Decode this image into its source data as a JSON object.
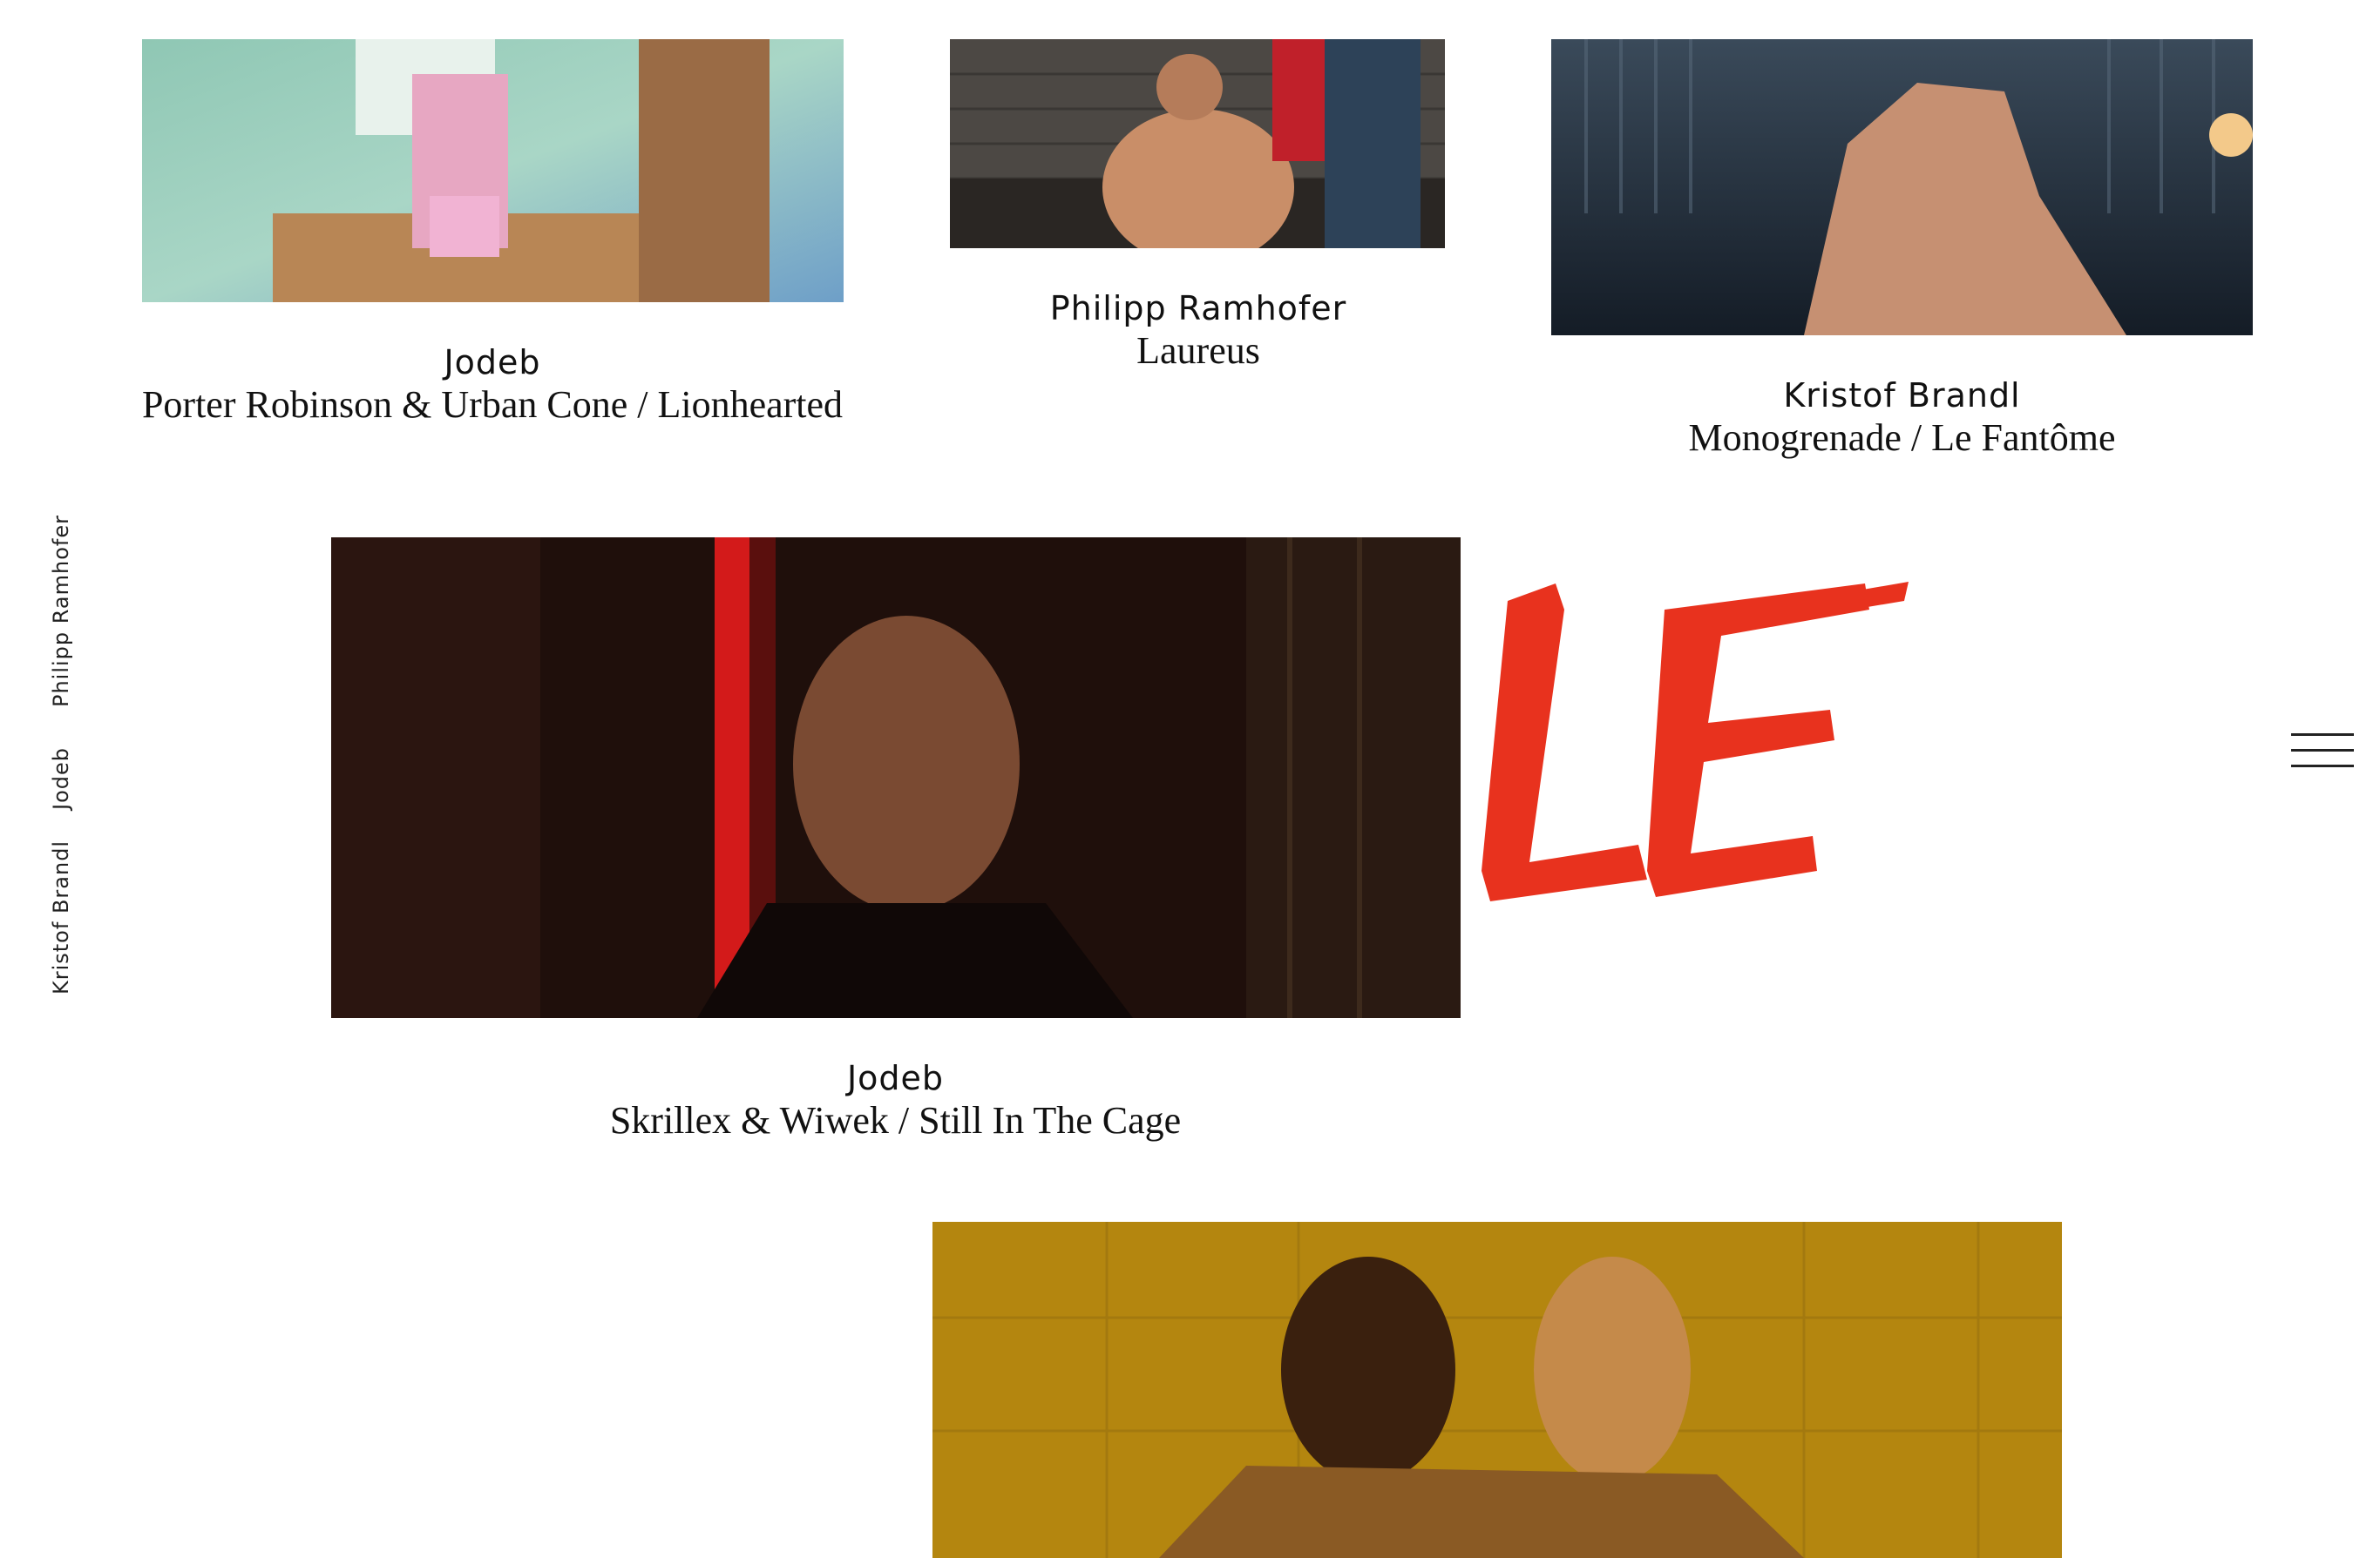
{
  "side_nav": {
    "items": [
      {
        "label": "Philipp Ramhofer"
      },
      {
        "label": "Jodeb"
      },
      {
        "label": "Kristof Brandl"
      }
    ]
  },
  "menu": {
    "icon": "hamburger-menu-icon"
  },
  "brand": {
    "color": "#e8321e"
  },
  "projects": [
    {
      "director": "Jodeb",
      "title": "Porter Robinson & Urban Cone / Lionhearted"
    },
    {
      "director": "Philipp Ramhofer",
      "title": "Laureus"
    },
    {
      "director": "Kristof Brandl",
      "title": "Monogrenade / Le Fantôme"
    },
    {
      "director": "Jodeb",
      "title": "Skrillex & Wiwek / Still In The Cage"
    },
    {
      "director": "",
      "title": ""
    }
  ]
}
